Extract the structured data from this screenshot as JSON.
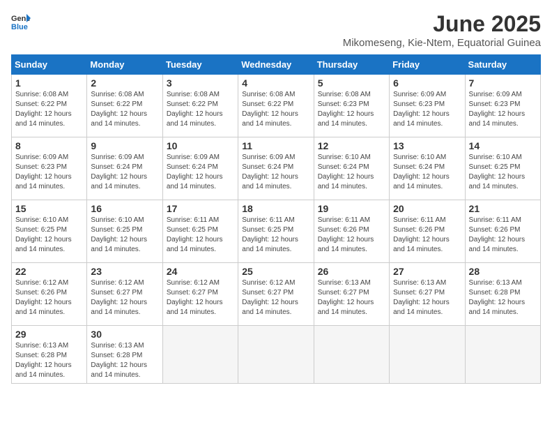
{
  "logo": {
    "general": "General",
    "blue": "Blue"
  },
  "title": "June 2025",
  "subtitle": "Mikomeseng, Kie-Ntem, Equatorial Guinea",
  "headers": [
    "Sunday",
    "Monday",
    "Tuesday",
    "Wednesday",
    "Thursday",
    "Friday",
    "Saturday"
  ],
  "weeks": [
    [
      {
        "day": "1",
        "sunrise": "6:08 AM",
        "sunset": "6:22 PM",
        "daylight": "12 hours and 14 minutes."
      },
      {
        "day": "2",
        "sunrise": "6:08 AM",
        "sunset": "6:22 PM",
        "daylight": "12 hours and 14 minutes."
      },
      {
        "day": "3",
        "sunrise": "6:08 AM",
        "sunset": "6:22 PM",
        "daylight": "12 hours and 14 minutes."
      },
      {
        "day": "4",
        "sunrise": "6:08 AM",
        "sunset": "6:22 PM",
        "daylight": "12 hours and 14 minutes."
      },
      {
        "day": "5",
        "sunrise": "6:08 AM",
        "sunset": "6:23 PM",
        "daylight": "12 hours and 14 minutes."
      },
      {
        "day": "6",
        "sunrise": "6:09 AM",
        "sunset": "6:23 PM",
        "daylight": "12 hours and 14 minutes."
      },
      {
        "day": "7",
        "sunrise": "6:09 AM",
        "sunset": "6:23 PM",
        "daylight": "12 hours and 14 minutes."
      }
    ],
    [
      {
        "day": "8",
        "sunrise": "6:09 AM",
        "sunset": "6:23 PM",
        "daylight": "12 hours and 14 minutes."
      },
      {
        "day": "9",
        "sunrise": "6:09 AM",
        "sunset": "6:24 PM",
        "daylight": "12 hours and 14 minutes."
      },
      {
        "day": "10",
        "sunrise": "6:09 AM",
        "sunset": "6:24 PM",
        "daylight": "12 hours and 14 minutes."
      },
      {
        "day": "11",
        "sunrise": "6:09 AM",
        "sunset": "6:24 PM",
        "daylight": "12 hours and 14 minutes."
      },
      {
        "day": "12",
        "sunrise": "6:10 AM",
        "sunset": "6:24 PM",
        "daylight": "12 hours and 14 minutes."
      },
      {
        "day": "13",
        "sunrise": "6:10 AM",
        "sunset": "6:24 PM",
        "daylight": "12 hours and 14 minutes."
      },
      {
        "day": "14",
        "sunrise": "6:10 AM",
        "sunset": "6:25 PM",
        "daylight": "12 hours and 14 minutes."
      }
    ],
    [
      {
        "day": "15",
        "sunrise": "6:10 AM",
        "sunset": "6:25 PM",
        "daylight": "12 hours and 14 minutes."
      },
      {
        "day": "16",
        "sunrise": "6:10 AM",
        "sunset": "6:25 PM",
        "daylight": "12 hours and 14 minutes."
      },
      {
        "day": "17",
        "sunrise": "6:11 AM",
        "sunset": "6:25 PM",
        "daylight": "12 hours and 14 minutes."
      },
      {
        "day": "18",
        "sunrise": "6:11 AM",
        "sunset": "6:25 PM",
        "daylight": "12 hours and 14 minutes."
      },
      {
        "day": "19",
        "sunrise": "6:11 AM",
        "sunset": "6:26 PM",
        "daylight": "12 hours and 14 minutes."
      },
      {
        "day": "20",
        "sunrise": "6:11 AM",
        "sunset": "6:26 PM",
        "daylight": "12 hours and 14 minutes."
      },
      {
        "day": "21",
        "sunrise": "6:11 AM",
        "sunset": "6:26 PM",
        "daylight": "12 hours and 14 minutes."
      }
    ],
    [
      {
        "day": "22",
        "sunrise": "6:12 AM",
        "sunset": "6:26 PM",
        "daylight": "12 hours and 14 minutes."
      },
      {
        "day": "23",
        "sunrise": "6:12 AM",
        "sunset": "6:27 PM",
        "daylight": "12 hours and 14 minutes."
      },
      {
        "day": "24",
        "sunrise": "6:12 AM",
        "sunset": "6:27 PM",
        "daylight": "12 hours and 14 minutes."
      },
      {
        "day": "25",
        "sunrise": "6:12 AM",
        "sunset": "6:27 PM",
        "daylight": "12 hours and 14 minutes."
      },
      {
        "day": "26",
        "sunrise": "6:13 AM",
        "sunset": "6:27 PM",
        "daylight": "12 hours and 14 minutes."
      },
      {
        "day": "27",
        "sunrise": "6:13 AM",
        "sunset": "6:27 PM",
        "daylight": "12 hours and 14 minutes."
      },
      {
        "day": "28",
        "sunrise": "6:13 AM",
        "sunset": "6:28 PM",
        "daylight": "12 hours and 14 minutes."
      }
    ],
    [
      {
        "day": "29",
        "sunrise": "6:13 AM",
        "sunset": "6:28 PM",
        "daylight": "12 hours and 14 minutes."
      },
      {
        "day": "30",
        "sunrise": "6:13 AM",
        "sunset": "6:28 PM",
        "daylight": "12 hours and 14 minutes."
      },
      null,
      null,
      null,
      null,
      null
    ]
  ]
}
